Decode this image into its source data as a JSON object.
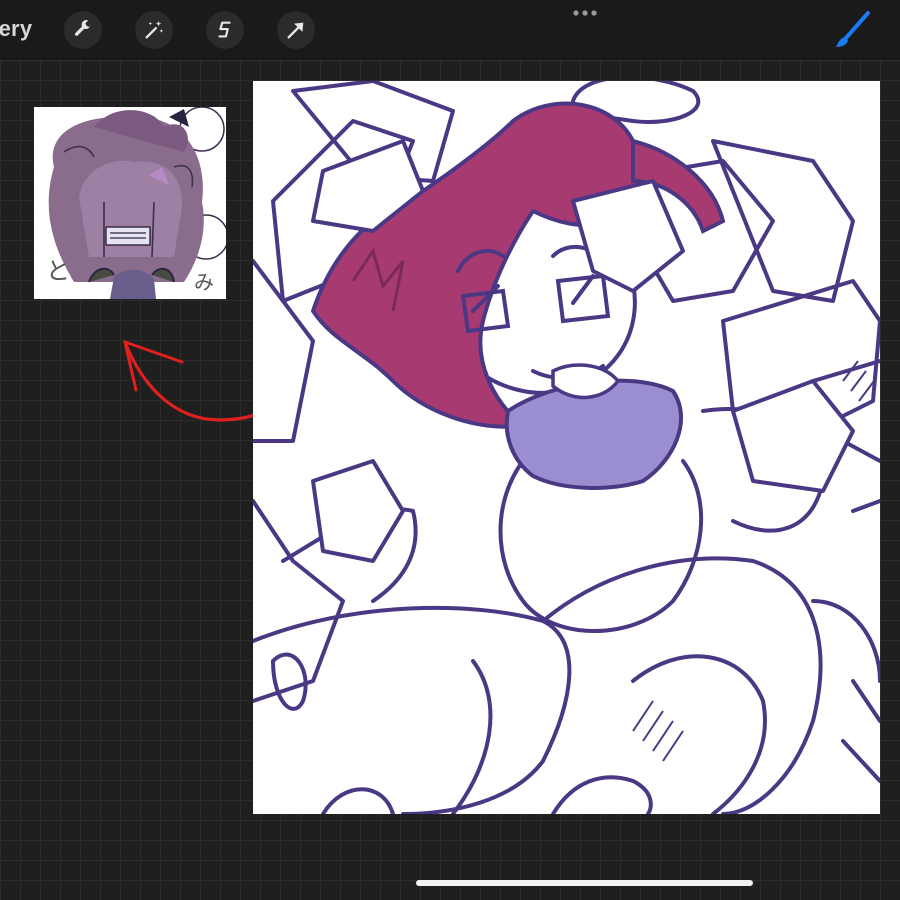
{
  "toolbar": {
    "gallery_label": "llery",
    "tools": [
      {
        "name": "actions",
        "icon": "wrench-icon"
      },
      {
        "name": "adjustments",
        "icon": "magic-wand-icon"
      },
      {
        "name": "selection",
        "icon": "selection-s-icon"
      },
      {
        "name": "transform",
        "icon": "arrow-cursor-icon"
      }
    ],
    "more_icon": "ellipsis-icon",
    "active_tool_icon": "brush-icon"
  },
  "reference": {
    "label_left": "と",
    "label_right": "み"
  },
  "colors": {
    "accent": "#1a7cf5",
    "hair": "#a83a72",
    "collar": "#9a8ed0",
    "lineart": "#4a3884",
    "annotation": "#e0201c"
  }
}
